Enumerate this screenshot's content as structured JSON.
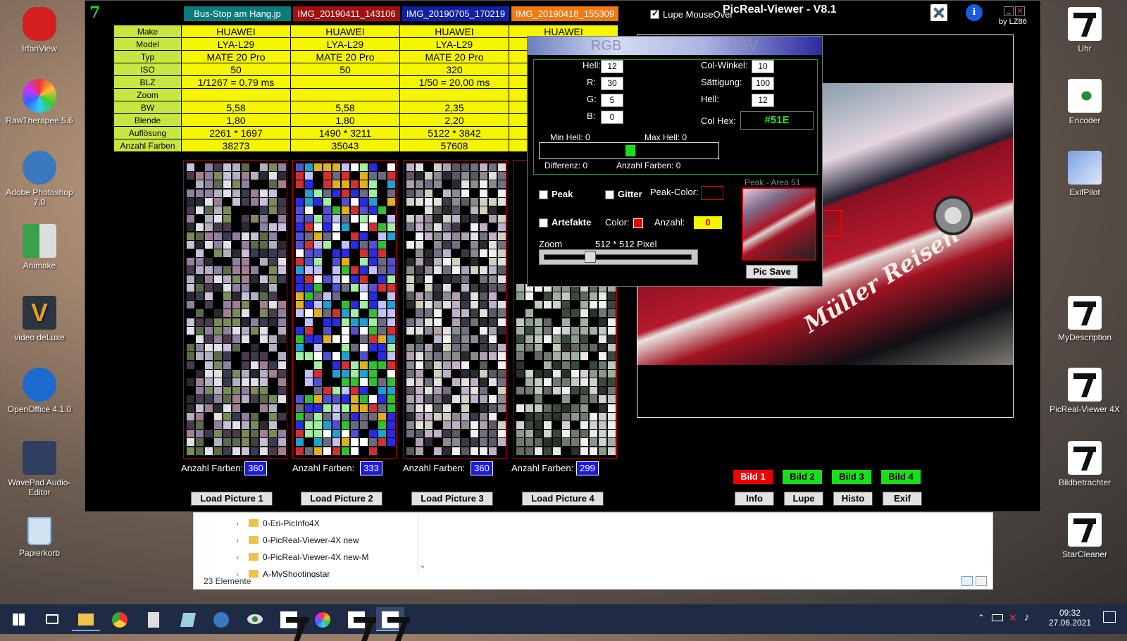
{
  "desktop": {
    "left_icons": [
      {
        "label": "IrfanView",
        "icon": "irfanview-icon",
        "color": "#d62020"
      },
      {
        "label": "RawTherapee 5.6",
        "icon": "rawtherapee-icon",
        "color": "#e85b8a"
      },
      {
        "label": "Adobe Photoshop 7.0",
        "icon": "photoshop-icon",
        "color": "#3a78c0"
      },
      {
        "label": "Animake",
        "icon": "animake-icon",
        "color": "#3aa04a"
      },
      {
        "label": "video deLuxe",
        "icon": "video-deluxe-icon",
        "color": "#e0a020"
      },
      {
        "label": "OpenOffice 4.1.0",
        "icon": "openoffice-icon",
        "color": "#1a6ad0"
      },
      {
        "label": "WavePad Audio-Editor",
        "icon": "wavepad-icon",
        "color": "#2f3f5f"
      },
      {
        "label": "Papierkorb",
        "icon": "recycle-bin-icon",
        "color": "#8ab4d8"
      }
    ],
    "right_icons": [
      {
        "label": "Uhr",
        "icon": "uhr-icon"
      },
      {
        "label": "Encoder",
        "icon": "encoder-icon"
      },
      {
        "label": "ExifPilot",
        "icon": "exifpilot-icon"
      },
      {
        "label": "MyDescription",
        "icon": "mydescription-icon"
      },
      {
        "label": "PicReal-Viewer 4X",
        "icon": "picreal-viewer-icon"
      },
      {
        "label": "Bildbetrachter",
        "icon": "bildbetrachter-icon"
      },
      {
        "label": "StarCleaner",
        "icon": "starcleaner-icon"
      }
    ]
  },
  "window": {
    "title": "PicReal-Viewer - V8.1",
    "by": "by LZ86",
    "lupe_label": "Lupe MouseOver",
    "tabs": [
      {
        "label": "Bus-Stop am Hang.jp",
        "color": "#0a7a7a"
      },
      {
        "label": "IMG_20190411_143106",
        "color": "#a01010"
      },
      {
        "label": "IMG_20190705_170219",
        "color": "#1020a0"
      },
      {
        "label": "IMG_20190418_155309",
        "color": "#f07a10"
      }
    ],
    "meta_labels": [
      "Make",
      "Model",
      "Typ",
      "ISO",
      "BLZ",
      "Zoom",
      "BW",
      "Blende",
      "Auflösung",
      "Anzahl Farben"
    ],
    "meta_columns": [
      [
        "HUAWEI",
        "LYA-L29",
        "MATE 20 Pro",
        "50",
        "1/1267 = 0,79 ms",
        "",
        "5,58",
        "1,80",
        "2261 * 1697",
        "38273"
      ],
      [
        "HUAWEI",
        "LYA-L29",
        "MATE 20 Pro",
        "50",
        "",
        "",
        "5,58",
        "1,80",
        "1490 * 3211",
        "35043"
      ],
      [
        "HUAWEI",
        "LYA-L29",
        "MATE 20 Pro",
        "320",
        "1/50 = 20,00 ms",
        "",
        "2,35",
        "2,20",
        "5122 * 3842",
        "57608"
      ],
      [
        "HUAWEI",
        "",
        "",
        "",
        "",
        "",
        "",
        "",
        "",
        ""
      ]
    ],
    "counts": {
      "label": "Anzahl Farben:",
      "values": [
        "360",
        "333",
        "360",
        "299"
      ]
    },
    "load_buttons": [
      "Load Picture 1",
      "Load Picture 2",
      "Load Picture 3",
      "Load Picture 4"
    ],
    "bild_buttons": [
      "Bild 1",
      "Bild 2",
      "Bild 3",
      "Bild 4"
    ],
    "action_buttons": [
      "Info",
      "Lupe",
      "Histo",
      "Exif"
    ]
  },
  "panel": {
    "rgb_label": "RGB",
    "hsv_label": "HSV",
    "hell_label": "Hell:",
    "hell": "12",
    "r_label": "R:",
    "r": "30",
    "g_label": "G:",
    "g": "5",
    "b_label": "B:",
    "b": "0",
    "colwinkel_label": "Col-Winkel:",
    "colwinkel": "10",
    "saettigung_label": "Sättigung:",
    "saettigung": "100",
    "hsv_hell_label": "Hell:",
    "hsv_hell": "12",
    "colhex_label": "Col Hex:",
    "colhex": "#51E",
    "min_hell": "Min Hell:  0",
    "max_hell": "Max Hell:  0",
    "differenz": "Differenz:  0",
    "anzahl_farben": "Anzahl Farben:  0",
    "peak_label": "Peak",
    "gitter_label": "Gitter",
    "peak_color_label": "Peak-Color:",
    "artefakte_label": "Artefakte",
    "color_label": "Color:",
    "anzahl_label": "Anzahl:",
    "anzahl_value": "0",
    "zoom_label": "Zoom",
    "zoom_value": "512 * 512 Pixel",
    "peak_area_label": "Peak - Area 51",
    "pic_save": "Pic Save"
  },
  "photo": {
    "caption": "Müller Reisen"
  },
  "explorer": {
    "items": [
      "0-Eri-PicInfo4X",
      "0-PicReal-Viewer-4X new",
      "0-PicReal-Viewer-4X new-M",
      "A-MyShootingstar"
    ],
    "count": "23 Elemente"
  },
  "taskbar": {
    "time": "09:32",
    "date": "27.06.2021"
  }
}
